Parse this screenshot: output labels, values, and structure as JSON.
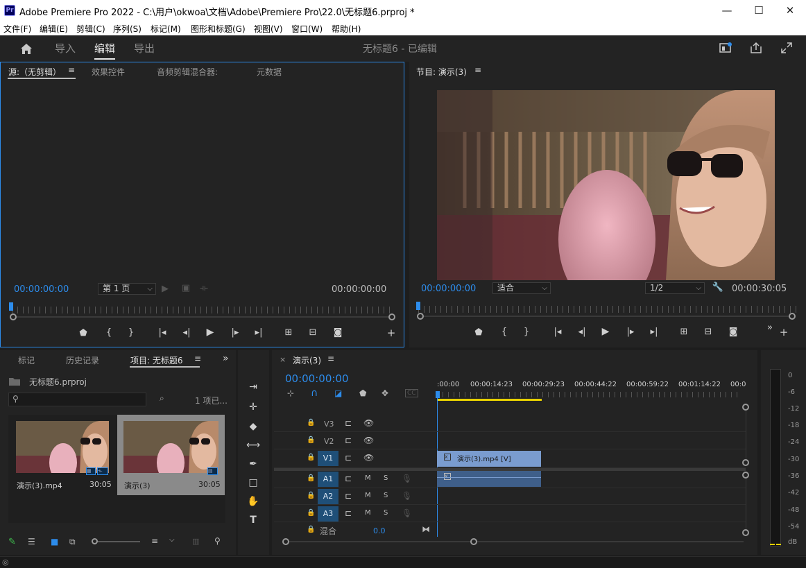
{
  "window": {
    "title": "Adobe Premiere Pro 2022 - C:\\用户\\okwoa\\文档\\Adobe\\Premiere Pro\\22.0\\无标题6.prproj *",
    "app_logo": "Pr",
    "minimize": "—",
    "maximize": "☐",
    "close": "✕"
  },
  "menu": [
    "文件(F)",
    "编辑(E)",
    "剪辑(C)",
    "序列(S)",
    "标记(M)",
    "图形和标题(G)",
    "视图(V)",
    "窗口(W)",
    "帮助(H)"
  ],
  "header": {
    "tabs": [
      "导入",
      "编辑",
      "导出"
    ],
    "active_tab": "编辑",
    "project_title": "无标题6 - 已编辑"
  },
  "source_panel": {
    "tabs": [
      "源:（无剪辑）",
      "效果控件",
      "音频剪辑混合器:",
      "元数据"
    ],
    "timecode_left": "00:00:00:00",
    "page_select": "第 1 页",
    "timecode_right": "00:00:00:00"
  },
  "program_panel": {
    "title": "节目: 演示(3)",
    "timecode_left": "00:00:00:00",
    "fit_select": "适合",
    "resolution_select": "1/2",
    "timecode_right": "00:00:30:05"
  },
  "project_panel": {
    "tabs": [
      "标记",
      "历史记录",
      "项目: 无标题6"
    ],
    "file_name": "无标题6.prproj",
    "item_count": "1 项已...",
    "items": [
      {
        "name": "演示(3).mp4",
        "duration": "30:05"
      },
      {
        "name": "演示(3)",
        "duration": "30:05"
      }
    ]
  },
  "timeline": {
    "tab": "演示(3)",
    "timecode": "00:00:00:00",
    "ruler_labels": [
      ":00:00",
      "00:00:14:23",
      "00:00:29:23",
      "00:00:44:22",
      "00:00:59:22",
      "00:01:14:22",
      "00:0"
    ],
    "video_tracks": [
      "V3",
      "V2",
      "V1"
    ],
    "audio_tracks": [
      "A1",
      "A2",
      "A3"
    ],
    "mute_label": "M",
    "solo_label": "S",
    "mix_label": "混合",
    "mix_value": "0.0",
    "video_clip": "演示(3).mp4 [V]"
  },
  "meter": {
    "labels": [
      "0",
      "-6",
      "-12",
      "-18",
      "-24",
      "-30",
      "-36",
      "-42",
      "-48",
      "-54",
      "dB"
    ]
  },
  "colors": {
    "accent": "#2d8ceb",
    "clip_video": "#7a9ccf",
    "clip_audio": "#3f5f8a",
    "work_area": "#e8d100"
  }
}
